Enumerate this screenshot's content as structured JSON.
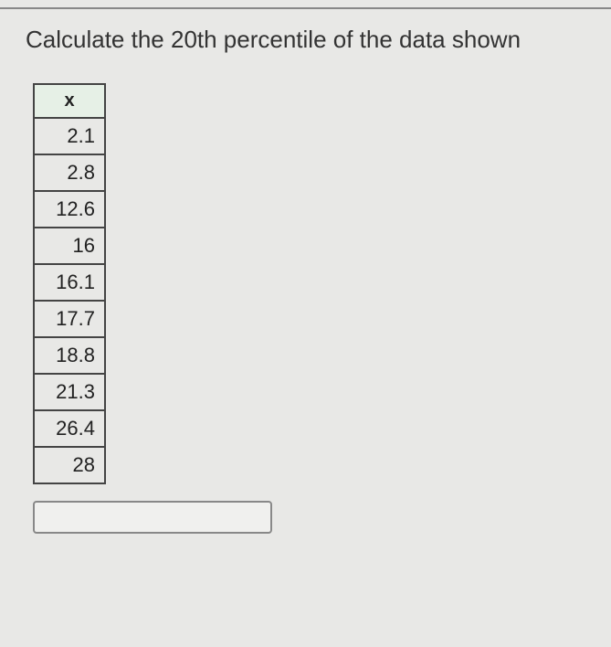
{
  "question": {
    "text": "Calculate the 20th percentile of the data shown"
  },
  "table": {
    "header": "x",
    "rows": [
      "2.1",
      "2.8",
      "12.6",
      "16",
      "16.1",
      "17.7",
      "18.8",
      "21.3",
      "26.4",
      "28"
    ]
  },
  "answer": {
    "value": "",
    "placeholder": ""
  },
  "chart_data": {
    "type": "table",
    "title": "Calculate the 20th percentile of the data shown",
    "columns": [
      "x"
    ],
    "values": [
      2.1,
      2.8,
      12.6,
      16,
      16.1,
      17.7,
      18.8,
      21.3,
      26.4,
      28
    ]
  }
}
